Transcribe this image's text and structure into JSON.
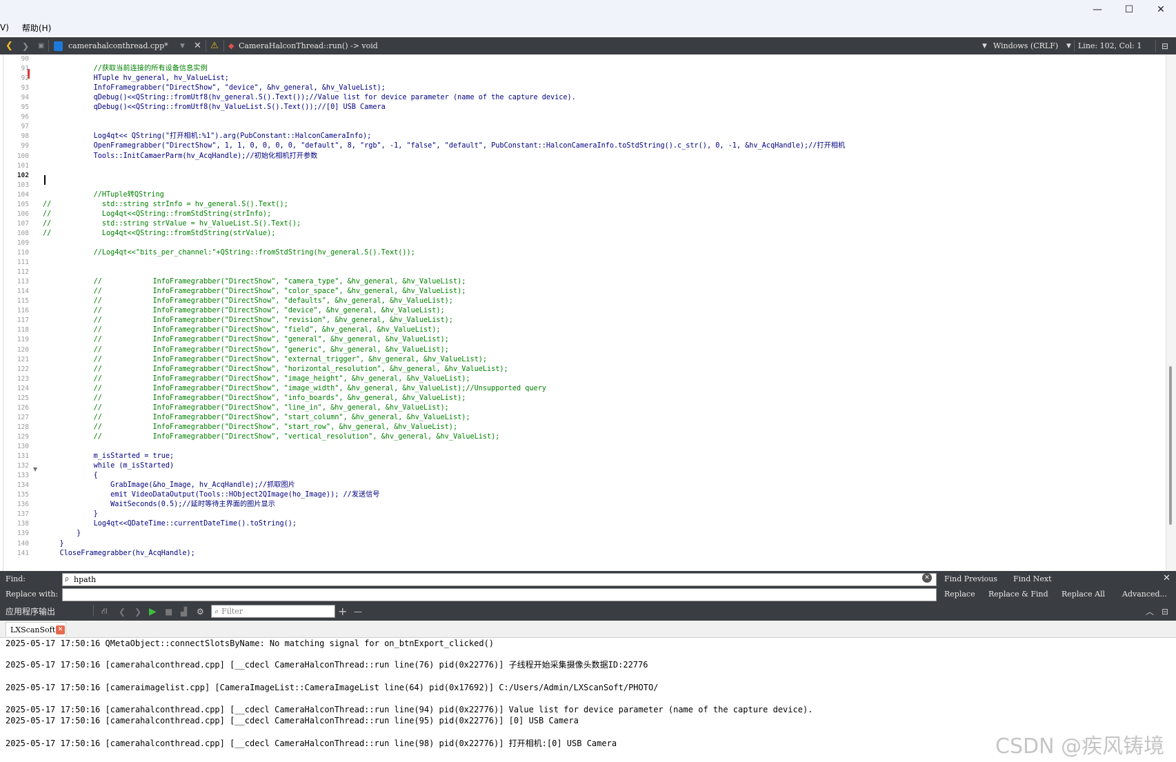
{
  "window": {
    "minimize_glyph": "—",
    "maximize_glyph": "☐",
    "close_glyph": "✕"
  },
  "menu": {
    "items": [
      "V)",
      "帮助(H)"
    ]
  },
  "editor_toolbar": {
    "back_icon": "back-arrow-icon",
    "forward_icon": "forward-arrow-icon",
    "lock_icon": "lock-icon",
    "file_name": "camerahalconthread.cpp*",
    "function_signature": "CameraHalconThread::run() -> void",
    "line_ending": "Windows (CRLF)",
    "cursor_position": "Line: 102, Col: 1",
    "accent_color": "#f0c020"
  },
  "editor": {
    "current_line": "102",
    "lines": [
      {
        "no": "90",
        "text": "",
        "comment": false
      },
      {
        "no": "91",
        "text": "            //获取当前连接的所有设备信息实例",
        "comment": true
      },
      {
        "no": "92",
        "text": "            HTuple hv_general, hv_ValueList;",
        "comment": false
      },
      {
        "no": "93",
        "text": "            InfoFramegrabber(\"DirectShow\", \"device\", &hv_general, &hv_ValueList);",
        "comment": false
      },
      {
        "no": "94",
        "text": "            qDebug()<<QString::fromUtf8(hv_general.S().Text());//Value list for device parameter (name of the capture device).",
        "comment": false
      },
      {
        "no": "95",
        "text": "            qDebug()<<QString::fromUtf8(hv_ValueList.S().Text());//[0] USB Camera",
        "comment": false
      },
      {
        "no": "96",
        "text": "",
        "comment": false
      },
      {
        "no": "97",
        "text": "",
        "comment": false
      },
      {
        "no": "98",
        "text": "            Log4qt<< QString(\"打开相机:%1\").arg(PubConstant::HalconCameraInfo);",
        "comment": false
      },
      {
        "no": "99",
        "text": "            OpenFramegrabber(\"DirectShow\", 1, 1, 0, 0, 0, 0, \"default\", 8, \"rgb\", -1, \"false\", \"default\", PubConstant::HalconCameraInfo.toStdString().c_str(), 0, -1, &hv_AcqHandle);//打开相机",
        "comment": false
      },
      {
        "no": "100",
        "text": "            Tools::InitCamaerParm(hv_AcqHandle);//初始化相机打开参数",
        "comment": false
      },
      {
        "no": "101",
        "text": "",
        "comment": false
      },
      {
        "no": "102",
        "text": "",
        "comment": false
      },
      {
        "no": "103",
        "text": "",
        "comment": false
      },
      {
        "no": "104",
        "text": "            //HTuple转QString",
        "comment": true
      },
      {
        "no": "105",
        "text": "//            std::string strInfo = hv_general.S().Text();",
        "comment": true
      },
      {
        "no": "106",
        "text": "//            Log4qt<<QString::fromStdString(strInfo);",
        "comment": true
      },
      {
        "no": "107",
        "text": "//            std::string strValue = hv_ValueList.S().Text();",
        "comment": true
      },
      {
        "no": "108",
        "text": "//            Log4qt<<QString::fromStdString(strValue);",
        "comment": true
      },
      {
        "no": "109",
        "text": "",
        "comment": false
      },
      {
        "no": "110",
        "text": "            //Log4qt<<\"bits_per_channel:\"+QString::fromStdString(hv_general.S().Text());",
        "comment": true
      },
      {
        "no": "111",
        "text": "",
        "comment": false
      },
      {
        "no": "112",
        "text": "",
        "comment": false
      },
      {
        "no": "113",
        "text": "            //            InfoFramegrabber(\"DirectShow\", \"camera_type\", &hv_general, &hv_ValueList);",
        "comment": true
      },
      {
        "no": "114",
        "text": "            //            InfoFramegrabber(\"DirectShow\", \"color_space\", &hv_general, &hv_ValueList);",
        "comment": true
      },
      {
        "no": "115",
        "text": "            //            InfoFramegrabber(\"DirectShow\", \"defaults\", &hv_general, &hv_ValueList);",
        "comment": true
      },
      {
        "no": "116",
        "text": "            //            InfoFramegrabber(\"DirectShow\", \"device\", &hv_general, &hv_ValueList);",
        "comment": true
      },
      {
        "no": "117",
        "text": "            //            InfoFramegrabber(\"DirectShow\", \"revision\", &hv_general, &hv_ValueList);",
        "comment": true
      },
      {
        "no": "118",
        "text": "            //            InfoFramegrabber(\"DirectShow\", \"field\", &hv_general, &hv_ValueList);",
        "comment": true
      },
      {
        "no": "119",
        "text": "            //            InfoFramegrabber(\"DirectShow\", \"general\", &hv_general, &hv_ValueList);",
        "comment": true
      },
      {
        "no": "120",
        "text": "            //            InfoFramegrabber(\"DirectShow\", \"generic\", &hv_general, &hv_ValueList);",
        "comment": true
      },
      {
        "no": "121",
        "text": "            //            InfoFramegrabber(\"DirectShow\", \"external_trigger\", &hv_general, &hv_ValueList);",
        "comment": true
      },
      {
        "no": "122",
        "text": "            //            InfoFramegrabber(\"DirectShow\", \"horizontal_resolution\", &hv_general, &hv_ValueList);",
        "comment": true
      },
      {
        "no": "123",
        "text": "            //            InfoFramegrabber(\"DirectShow\", \"image_height\", &hv_general, &hv_ValueList);",
        "comment": true
      },
      {
        "no": "124",
        "text": "            //            InfoFramegrabber(\"DirectShow\", \"image_width\", &hv_general, &hv_ValueList);//Unsupported query",
        "comment": true
      },
      {
        "no": "125",
        "text": "            //            InfoFramegrabber(\"DirectShow\", \"info_boards\", &hv_general, &hv_ValueList);",
        "comment": true
      },
      {
        "no": "126",
        "text": "            //            InfoFramegrabber(\"DirectShow\", \"line_in\", &hv_general, &hv_ValueList);",
        "comment": true
      },
      {
        "no": "127",
        "text": "            //            InfoFramegrabber(\"DirectShow\", \"start_column\", &hv_general, &hv_ValueList);",
        "comment": true
      },
      {
        "no": "128",
        "text": "            //            InfoFramegrabber(\"DirectShow\", \"start_row\", &hv_general, &hv_ValueList);",
        "comment": true
      },
      {
        "no": "129",
        "text": "            //            InfoFramegrabber(\"DirectShow\", \"vertical_resolution\", &hv_general, &hv_ValueList);",
        "comment": true
      },
      {
        "no": "130",
        "text": "",
        "comment": false
      },
      {
        "no": "131",
        "text": "            m_isStarted = true;",
        "comment": false
      },
      {
        "no": "132",
        "text": "            while (m_isStarted)",
        "comment": false
      },
      {
        "no": "133",
        "text": "            {",
        "comment": false
      },
      {
        "no": "134",
        "text": "                GrabImage(&ho_Image, hv_AcqHandle);//抓取图片",
        "comment": false
      },
      {
        "no": "135",
        "text": "                emit VideoDataOutput(Tools::HObject2QImage(ho_Image)); //发送信号",
        "comment": false
      },
      {
        "no": "136",
        "text": "                WaitSeconds(0.5);//延时等待主界面的图片显示",
        "comment": false
      },
      {
        "no": "137",
        "text": "            }",
        "comment": false
      },
      {
        "no": "138",
        "text": "            Log4qt<<QDateTime::currentDateTime().toString();",
        "comment": false
      },
      {
        "no": "139",
        "text": "        }",
        "comment": false
      },
      {
        "no": "140",
        "text": "    }",
        "comment": false
      },
      {
        "no": "141",
        "text": "    CloseFramegrabber(hv_AcqHandle);",
        "comment": false
      }
    ]
  },
  "find_bar": {
    "find_label": "Find:",
    "find_value": "hpath",
    "replace_label": "Replace with:",
    "replace_value": "",
    "find_previous": "Find Previous",
    "find_next": "Find Next",
    "replace": "Replace",
    "replace_and_find": "Replace & Find",
    "replace_all": "Replace All",
    "advanced": "Advanced..."
  },
  "output_pane": {
    "title": "应用程序输出",
    "filter_placeholder": "Filter",
    "add_glyph": "+",
    "remove_glyph": "—",
    "tab_label": "LXScanSoft",
    "log_lines": [
      "2025-05-17 17:50:16 QMetaObject::connectSlotsByName: No matching signal for on_btnExport_clicked()",
      "",
      "2025-05-17 17:50:16 [camerahalconthread.cpp] [__cdecl CameraHalconThread::run line(76) pid(0x22776)] 子线程开始采集摄像头数据ID:22776",
      "",
      "2025-05-17 17:50:16 [cameraimagelist.cpp] [CameraImageList::CameraImageList line(64) pid(0x17692)] C:/Users/Admin/LXScanSoft/PHOTO/",
      "",
      "2025-05-17 17:50:16 [camerahalconthread.cpp] [__cdecl CameraHalconThread::run line(94) pid(0x22776)] Value list for device parameter (name of the capture device).",
      "2025-05-17 17:50:16 [camerahalconthread.cpp] [__cdecl CameraHalconThread::run line(95) pid(0x22776)] [0] USB Camera",
      "",
      "2025-05-17 17:50:16 [camerahalconthread.cpp] [__cdecl CameraHalconThread::run line(98) pid(0x22776)] 打开相机:[0] USB Camera"
    ]
  },
  "watermark": "CSDN @疾风铸境"
}
